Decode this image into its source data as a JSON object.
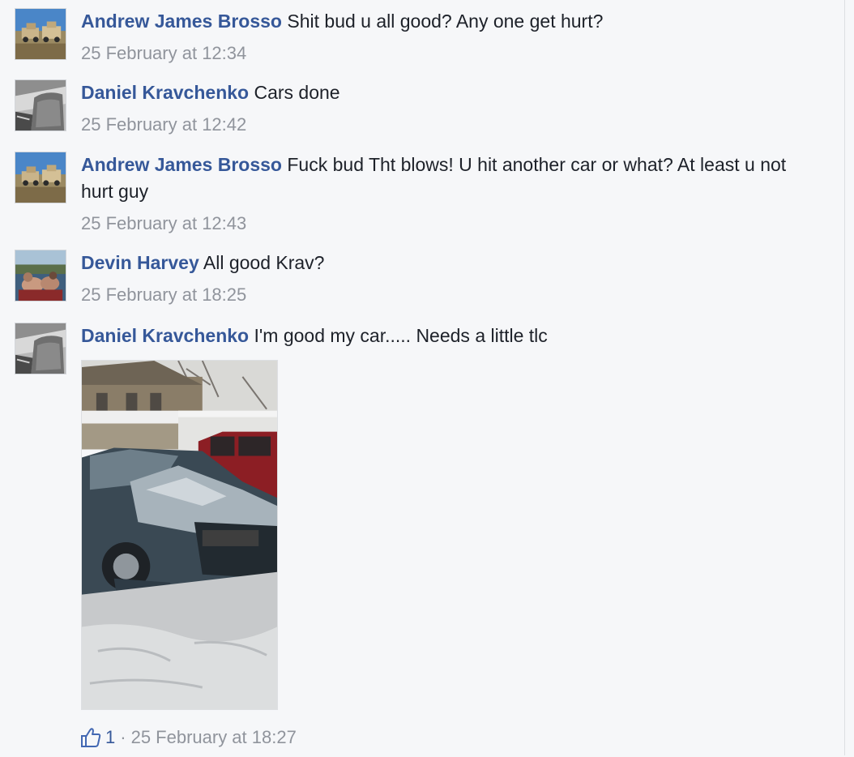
{
  "comments": [
    {
      "author": "Andrew James Brosso",
      "text": "Shit bud u all good? Any one get hurt?",
      "time": "25 February at 12:34",
      "avatar": "truck-avatar"
    },
    {
      "author": "Daniel Kravchenko",
      "text": "Cars done",
      "time": "25 February at 12:42",
      "avatar": "snow-avatar"
    },
    {
      "author": "Andrew James Brosso",
      "text": "Fuck bud Tht blows! U hit another car or what? At least u not hurt guy",
      "time": "25 February at 12:43",
      "avatar": "truck-avatar"
    },
    {
      "author": "Devin Harvey",
      "text": "All good Krav?",
      "time": "25 February at 18:25",
      "avatar": "lake-avatar"
    },
    {
      "author": "Daniel Kravchenko",
      "text": "I'm good my car..... Needs a little tlc",
      "time": "",
      "avatar": "snow-avatar",
      "attachment": "crashed-car-photo"
    }
  ],
  "last_comment_footer": {
    "like_icon": "thumbs-up-icon",
    "like_count": "1",
    "separator": "·",
    "time": "25 February at 18:27"
  },
  "colors": {
    "author_link": "#365899",
    "meta_text": "#90949c",
    "body_text": "#1d2129",
    "background": "#f6f7f9"
  }
}
